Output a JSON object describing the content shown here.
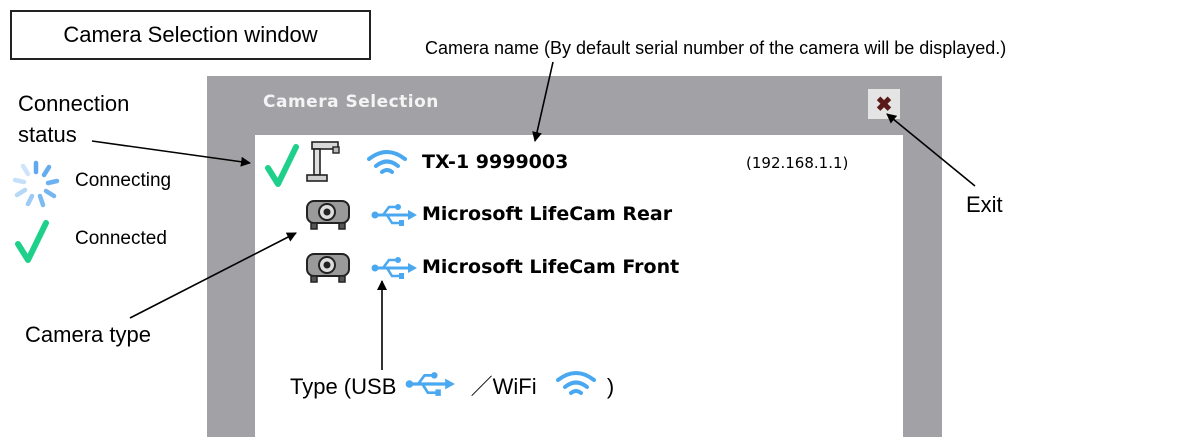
{
  "diagram_title": "Camera Selection window",
  "labels": {
    "camera_name": "Camera name (By default serial number of the camera will be displayed.)",
    "connection_status_line1": "Connection",
    "connection_status_line2": "status",
    "connecting": "Connecting",
    "connected": "Connected",
    "camera_type": "Camera type",
    "exit": "Exit",
    "type_prefix": "Type (USB",
    "type_separator": "／WiFi",
    "type_suffix": ")"
  },
  "window": {
    "title": "Camera Selection",
    "close_symbol": "✖",
    "cameras": [
      {
        "name": "TX-1 9999003",
        "ip": "(192.168.1.1)",
        "connection": "wifi",
        "camera_type": "document-camera",
        "status": "connected"
      },
      {
        "name": "Microsoft LifeCam Rear",
        "connection": "usb",
        "camera_type": "projector-camera"
      },
      {
        "name": "Microsoft LifeCam Front",
        "connection": "usb",
        "camera_type": "projector-camera"
      }
    ]
  },
  "colors": {
    "window_frame": "#a2a2a6",
    "checkmark": "#1fd08a",
    "connection_icon": "#4aa8f0",
    "spinner": "#5ea9ef"
  }
}
